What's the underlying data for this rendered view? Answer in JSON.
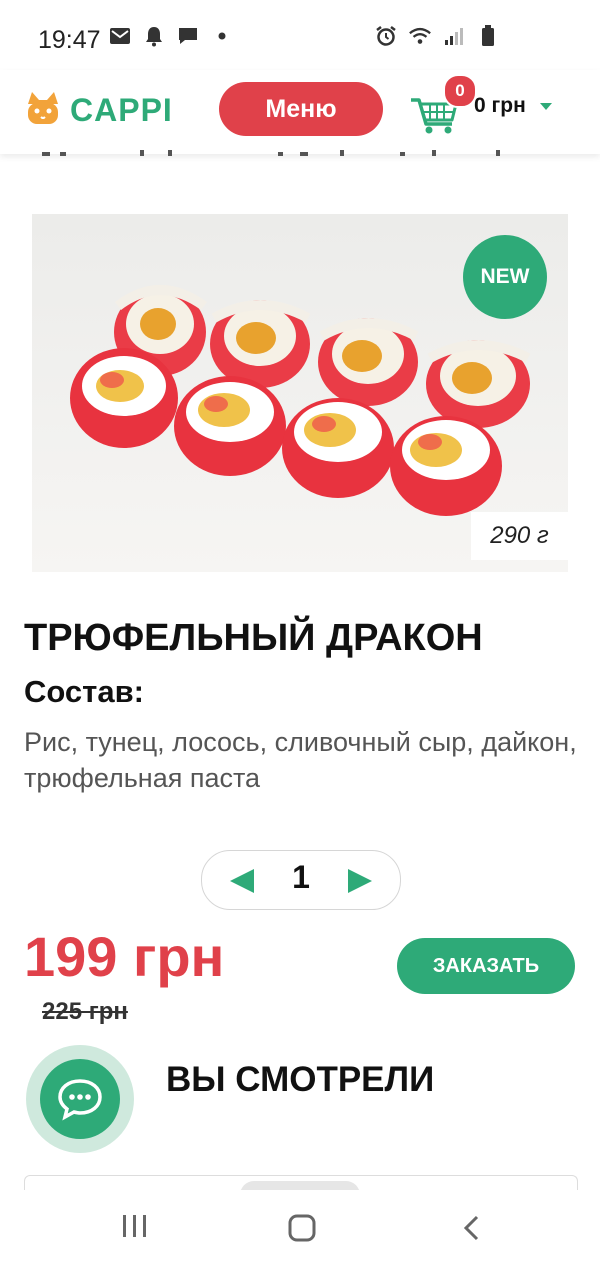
{
  "status_bar": {
    "time": "19:47",
    "left_icons": [
      "mail-icon",
      "bell-icon",
      "message-icon",
      "dot-icon"
    ],
    "right_icons": [
      "alarm-icon",
      "wifi-icon",
      "signal-icon",
      "battery-icon"
    ]
  },
  "header": {
    "logo_text": "CAPPI",
    "menu_label": "Меню",
    "cart_count": "0",
    "cart_total": "0 грн"
  },
  "product": {
    "badge": "NEW",
    "weight": "290 г",
    "title": "ТРЮФЕЛЬНЫЙ ДРАКОН",
    "composition_label": "Состав:",
    "composition": "Рис, тунец, лосось, сливочный сыр, дайкон, трюфельная паста",
    "quantity": "1",
    "price": "199 грн",
    "old_price": "225 грн",
    "order_label": "ЗАКАЗАТЬ"
  },
  "viewed": {
    "title": "ВЫ СМОТРЕЛИ"
  },
  "colors": {
    "accent_green": "#2eaa78",
    "accent_red": "#e0414a"
  }
}
